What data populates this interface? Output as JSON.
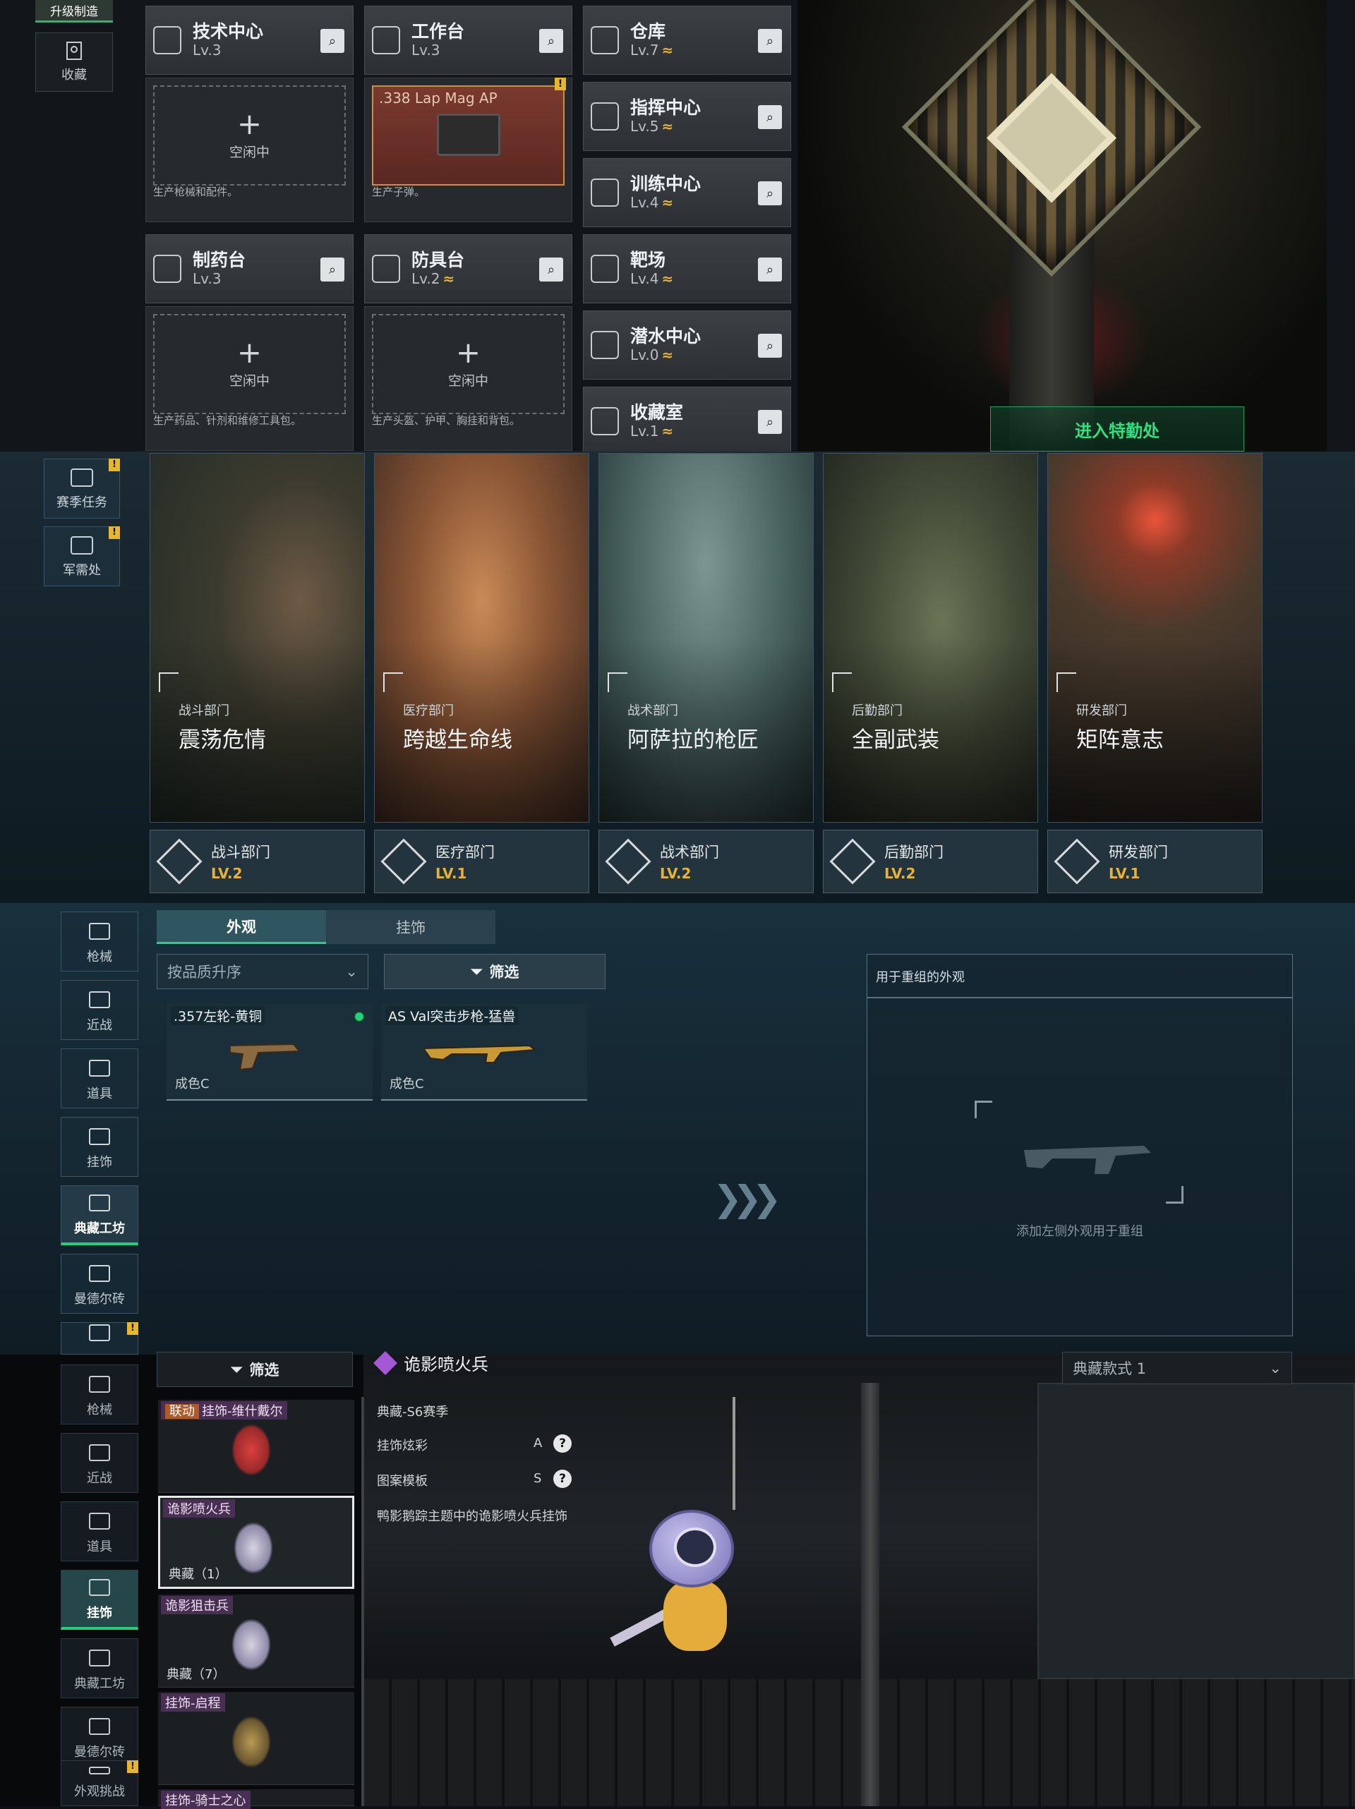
{
  "panel1": {
    "upgrade_tab": "升级制造",
    "favorites_label": "收藏",
    "facilities_left": [
      {
        "name": "技术中心",
        "level": "Lv.3",
        "upgradable": false,
        "slot_idle": "空闲中",
        "slot_desc": "生产枪械和配件。"
      },
      {
        "name": "工作台",
        "level": "Lv.3",
        "upgradable": false,
        "slot_item": ".338 Lap Mag AP",
        "slot_desc": "生产子弹。"
      },
      {
        "name": "制药台",
        "level": "Lv.3",
        "upgradable": false,
        "slot_idle": "空闲中",
        "slot_desc": "生产药品、针剂和维修工具包。"
      },
      {
        "name": "防具台",
        "level": "Lv.2",
        "upgradable": true,
        "slot_idle": "空闲中",
        "slot_desc": "生产头盔、护甲、胸挂和背包。"
      }
    ],
    "facilities_right": [
      {
        "name": "仓库",
        "level": "Lv.7",
        "upgradable": true
      },
      {
        "name": "指挥中心",
        "level": "Lv.5",
        "upgradable": true
      },
      {
        "name": "训练中心",
        "level": "Lv.4",
        "upgradable": true
      },
      {
        "name": "靶场",
        "level": "Lv.4",
        "upgradable": true
      },
      {
        "name": "潜水中心",
        "level": "Lv.0",
        "upgradable": true
      },
      {
        "name": "收藏室",
        "level": "Lv.1",
        "upgradable": true
      }
    ],
    "upgrade_symbol": "≈",
    "warning_mark": "!",
    "enter_button": "进入特勤处"
  },
  "panel2": {
    "side_buttons": [
      "赛季任务",
      "军需处"
    ],
    "cards": [
      {
        "dept": "战斗部门",
        "title": "震荡危情",
        "color": "#4f5d4a"
      },
      {
        "dept": "医疗部门",
        "title": "跨越生命线",
        "color": "#a0633a"
      },
      {
        "dept": "战术部门",
        "title": "阿萨拉的枪匠",
        "color": "#4e6966"
      },
      {
        "dept": "后勤部门",
        "title": "全副武装",
        "color": "#4a513d"
      },
      {
        "dept": "研发部门",
        "title": "矩阵意志",
        "color": "#463c32"
      }
    ],
    "departments": [
      {
        "name": "战斗部门",
        "level": "LV.2"
      },
      {
        "name": "医疗部门",
        "level": "LV.1"
      },
      {
        "name": "战术部门",
        "level": "LV.2"
      },
      {
        "name": "后勤部门",
        "level": "LV.2"
      },
      {
        "name": "研发部门",
        "level": "LV.1"
      }
    ]
  },
  "panel3": {
    "nav": [
      "枪械",
      "近战",
      "道具",
      "挂饰",
      "典藏工坊",
      "曼德尔砖"
    ],
    "active_nav": "典藏工坊",
    "tabs": [
      "外观",
      "挂饰"
    ],
    "sort_label": "按品质升序",
    "filter_label": "筛选",
    "skins": [
      {
        "name": ".357左轮-黄铜",
        "quality": "成色C",
        "selected": true
      },
      {
        "name": "AS Val突击步枪-猛兽",
        "quality": "成色C",
        "selected": false
      }
    ],
    "recombine_title": "用于重组的外观",
    "recombine_hint": "添加左侧外观用于重组",
    "arrow_glyph": "❯❯❯"
  },
  "panel4": {
    "filter_label": "筛选",
    "nav": [
      "枪械",
      "近战",
      "道具",
      "挂饰",
      "典藏工坊",
      "曼德尔砖",
      "外观挑战"
    ],
    "active_nav": "挂饰",
    "pendants": [
      {
        "linked_tag": "联动",
        "name": "挂饰-维什戴尔",
        "count": ""
      },
      {
        "name": "诡影喷火兵",
        "count": "典藏（1）",
        "selected": true
      },
      {
        "name": "诡影狙击兵",
        "count": "典藏（7）"
      },
      {
        "name": "挂饰-启程",
        "count": ""
      },
      {
        "name": "挂饰-骑士之心",
        "count": ""
      }
    ],
    "title": "诡影喷火兵",
    "info": [
      {
        "label": "典藏-S6赛季",
        "value": ""
      },
      {
        "label": "挂饰炫彩",
        "value": "A"
      },
      {
        "label": "图案模板",
        "value": "S"
      },
      {
        "label": "鸭影鹅踪主题中的诡影喷火兵挂饰",
        "value": ""
      }
    ],
    "help_glyph": "?",
    "variant_label": "典藏款式 1"
  }
}
